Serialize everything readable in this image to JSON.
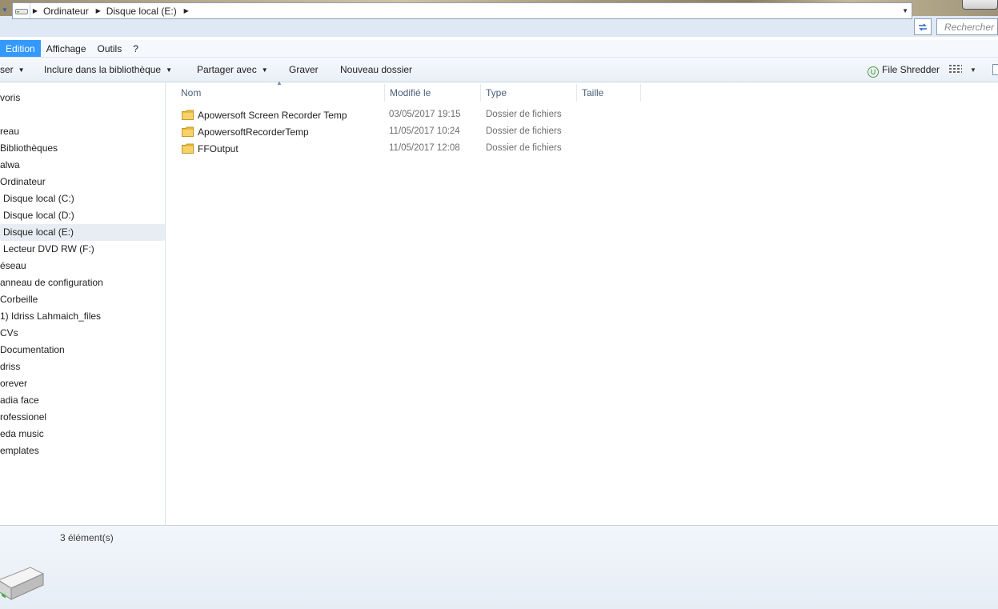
{
  "address": {
    "breadcrumbs": [
      "Ordinateur",
      "Disque local (E:)"
    ],
    "search_placeholder": "Rechercher d"
  },
  "menu": {
    "items": [
      "Edition",
      "Affichage",
      "Outils",
      "?"
    ],
    "active": "Edition"
  },
  "toolbar": {
    "organize": "ser",
    "include_library": "Inclure dans la bibliothèque",
    "share_with": "Partager avec",
    "burn": "Graver",
    "new_folder": "Nouveau dossier",
    "file_shredder": "File Shredder",
    "file_shredder_icon": "U"
  },
  "nav": {
    "items": [
      {
        "label": "voris"
      },
      {
        "label": "reau"
      },
      {
        "label": "Bibliothèques"
      },
      {
        "label": "alwa"
      },
      {
        "label": "Ordinateur"
      },
      {
        "label": "Disque local (C:)"
      },
      {
        "label": "Disque local (D:)"
      },
      {
        "label": "Disque local (E:)",
        "selected": true
      },
      {
        "label": "Lecteur DVD RW (F:)"
      },
      {
        "label": "éseau"
      },
      {
        "label": "anneau de configuration"
      },
      {
        "label": "Corbeille"
      },
      {
        "label": "1) Idriss Lahmaich_files"
      },
      {
        "label": "CVs"
      },
      {
        "label": "Documentation"
      },
      {
        "label": "driss"
      },
      {
        "label": "orever"
      },
      {
        "label": "adia face"
      },
      {
        "label": "rofessionel"
      },
      {
        "label": "eda music"
      },
      {
        "label": "emplates"
      }
    ]
  },
  "columns": {
    "name": "Nom",
    "modified": "Modifié le",
    "type": "Type",
    "size": "Taille"
  },
  "files": [
    {
      "name": "Apowersoft Screen Recorder Temp",
      "modified": "03/05/2017 19:15",
      "type": "Dossier de fichiers"
    },
    {
      "name": "ApowersoftRecorderTemp",
      "modified": "11/05/2017 10:24",
      "type": "Dossier de fichiers"
    },
    {
      "name": "FFOutput",
      "modified": "11/05/2017 12:08",
      "type": "Dossier de fichiers"
    }
  ],
  "status": {
    "item_count": "3 élément(s)"
  },
  "colors": {
    "menu_active": "#3399ff",
    "folder": "#f0c64a",
    "column_header_text": "#4c607a"
  }
}
